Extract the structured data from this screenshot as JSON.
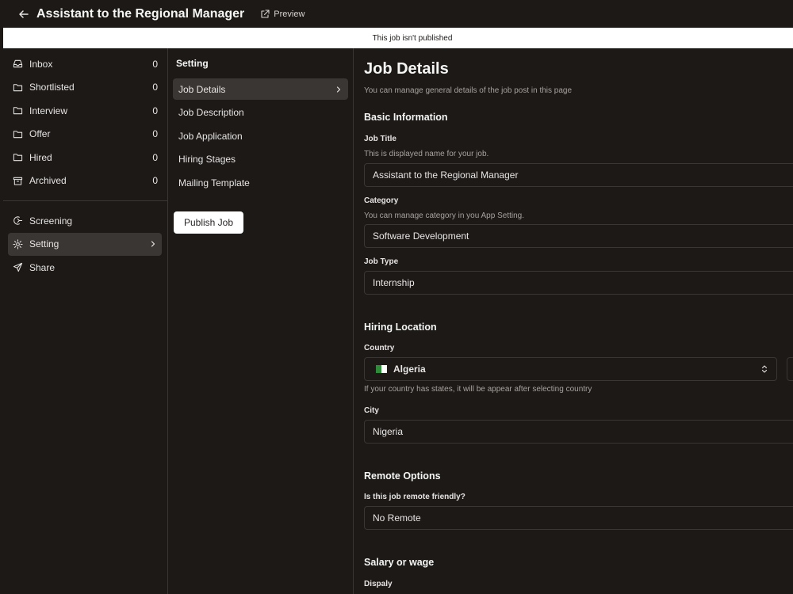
{
  "header": {
    "title": "Assistant to the Regional Manager",
    "preview_label": "Preview"
  },
  "banner": {
    "text": "This job isn't published"
  },
  "sidebar": {
    "pipeline": [
      {
        "label": "Inbox",
        "count": "0",
        "icon": "inbox-icon"
      },
      {
        "label": "Shortlisted",
        "count": "0",
        "icon": "folder-icon"
      },
      {
        "label": "Interview",
        "count": "0",
        "icon": "folder-icon"
      },
      {
        "label": "Offer",
        "count": "0",
        "icon": "folder-icon"
      },
      {
        "label": "Hired",
        "count": "0",
        "icon": "folder-icon"
      },
      {
        "label": "Archived",
        "count": "0",
        "icon": "archive-icon"
      }
    ],
    "tools": [
      {
        "label": "Screening",
        "icon": "screening-icon"
      },
      {
        "label": "Setting",
        "icon": "gear-icon",
        "active": true
      },
      {
        "label": "Share",
        "icon": "send-icon"
      }
    ]
  },
  "settings": {
    "heading": "Setting",
    "items": [
      {
        "label": "Job Details",
        "active": true
      },
      {
        "label": "Job Description"
      },
      {
        "label": "Job Application"
      },
      {
        "label": "Hiring Stages"
      },
      {
        "label": "Mailing Template"
      }
    ],
    "publish_label": "Publish Job"
  },
  "main": {
    "title": "Job Details",
    "subtitle": "You can manage general details of the job post in this page",
    "basic_info": {
      "title": "Basic Information",
      "job_title_label": "Job Title",
      "job_title_hint": "This is displayed name for your job.",
      "job_title_value": "Assistant to the Regional Manager",
      "category_label": "Category",
      "category_hint": "You can manage category in you App Setting.",
      "category_value": "Software Development",
      "job_type_label": "Job Type",
      "job_type_value": "Internship"
    },
    "location": {
      "title": "Hiring Location",
      "country_label": "Country",
      "country_value": "Algeria",
      "country_hint": "If your country has states, it will be appear after selecting country",
      "city_label": "City",
      "city_value": "Nigeria"
    },
    "remote": {
      "title": "Remote Options",
      "question": "Is this job remote friendly?",
      "value": "No Remote"
    },
    "salary": {
      "title": "Salary or wage",
      "display_label": "Dispaly"
    }
  },
  "colors": {
    "background": "#1c1917",
    "border": "#3a3633",
    "active": "#3a3633",
    "flag_green": "#2e8b3a",
    "flag_white": "#ffffff"
  }
}
